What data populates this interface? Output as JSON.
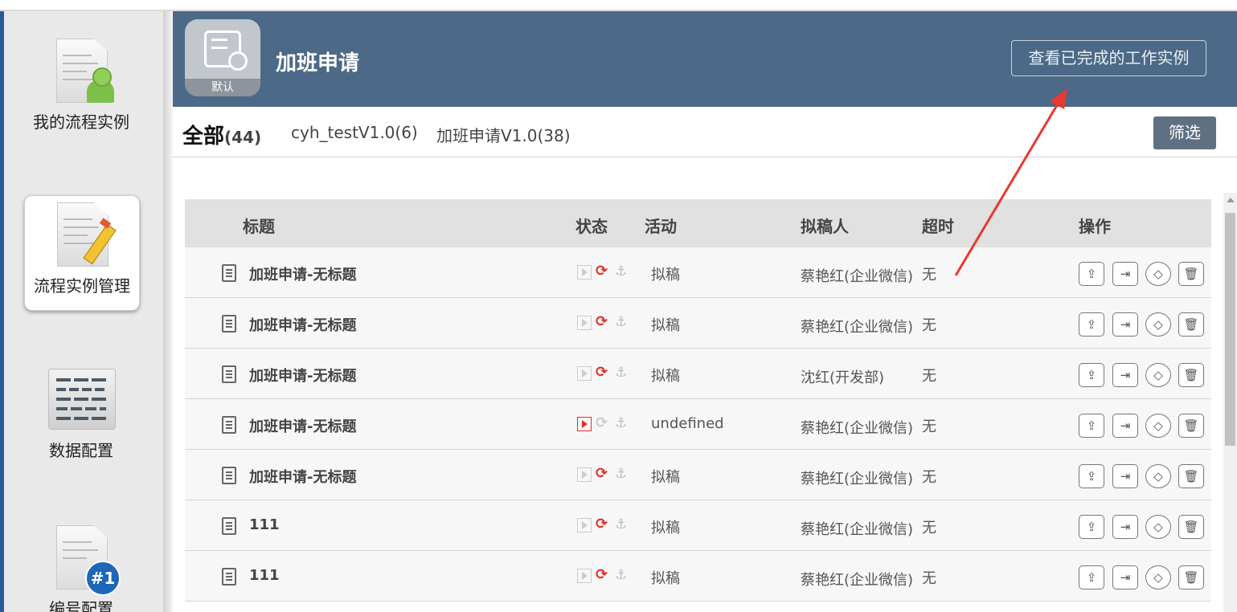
{
  "sidebar": {
    "items": [
      {
        "label": "我的流程实例",
        "icon": "process-user-icon"
      },
      {
        "label": "流程实例管理",
        "icon": "process-edit-icon"
      },
      {
        "label": "数据配置",
        "icon": "data-table-icon"
      },
      {
        "label": "编号配置",
        "icon": "number-icon"
      }
    ]
  },
  "header": {
    "app_icon_caption": "默认",
    "title": "加班申请",
    "view_completed_label": "查看已完成的工作实例"
  },
  "tabs": {
    "all_label": "全部",
    "all_count": "(44)",
    "items": [
      "cyh_testV1.0(6)",
      "加班申请V1.0(38)"
    ],
    "filter_label": "筛选"
  },
  "table": {
    "columns": {
      "title": "标题",
      "status": "状态",
      "activity": "活动",
      "drafter": "拟稿人",
      "timeout": "超时",
      "actions": "操作"
    },
    "rows": [
      {
        "title": "加班申请-无标题",
        "status_play": false,
        "status_sync": true,
        "activity": "拟稿",
        "drafter": "蔡艳红(企业微信)",
        "timeout": "无"
      },
      {
        "title": "加班申请-无标题",
        "status_play": false,
        "status_sync": true,
        "activity": "拟稿",
        "drafter": "蔡艳红(企业微信)",
        "timeout": "无"
      },
      {
        "title": "加班申请-无标题",
        "status_play": false,
        "status_sync": true,
        "activity": "拟稿",
        "drafter": "沈红(开发部)",
        "timeout": "无"
      },
      {
        "title": "加班申请-无标题",
        "status_play": true,
        "status_sync": false,
        "activity": "undefined",
        "drafter": "蔡艳红(企业微信)",
        "timeout": "无"
      },
      {
        "title": "加班申请-无标题",
        "status_play": false,
        "status_sync": true,
        "activity": "拟稿",
        "drafter": "蔡艳红(企业微信)",
        "timeout": "无"
      },
      {
        "title": "111",
        "status_play": false,
        "status_sync": true,
        "activity": "拟稿",
        "drafter": "蔡艳红(企业微信)",
        "timeout": "无"
      },
      {
        "title": "111",
        "status_play": false,
        "status_sync": true,
        "activity": "拟稿",
        "drafter": "蔡艳红(企业微信)",
        "timeout": "无"
      }
    ]
  },
  "colors": {
    "header_bg": "#4c6987",
    "accent_red": "#e0302a",
    "filter_bg": "#5f7083",
    "annotation_arrow": "#e8392f"
  }
}
